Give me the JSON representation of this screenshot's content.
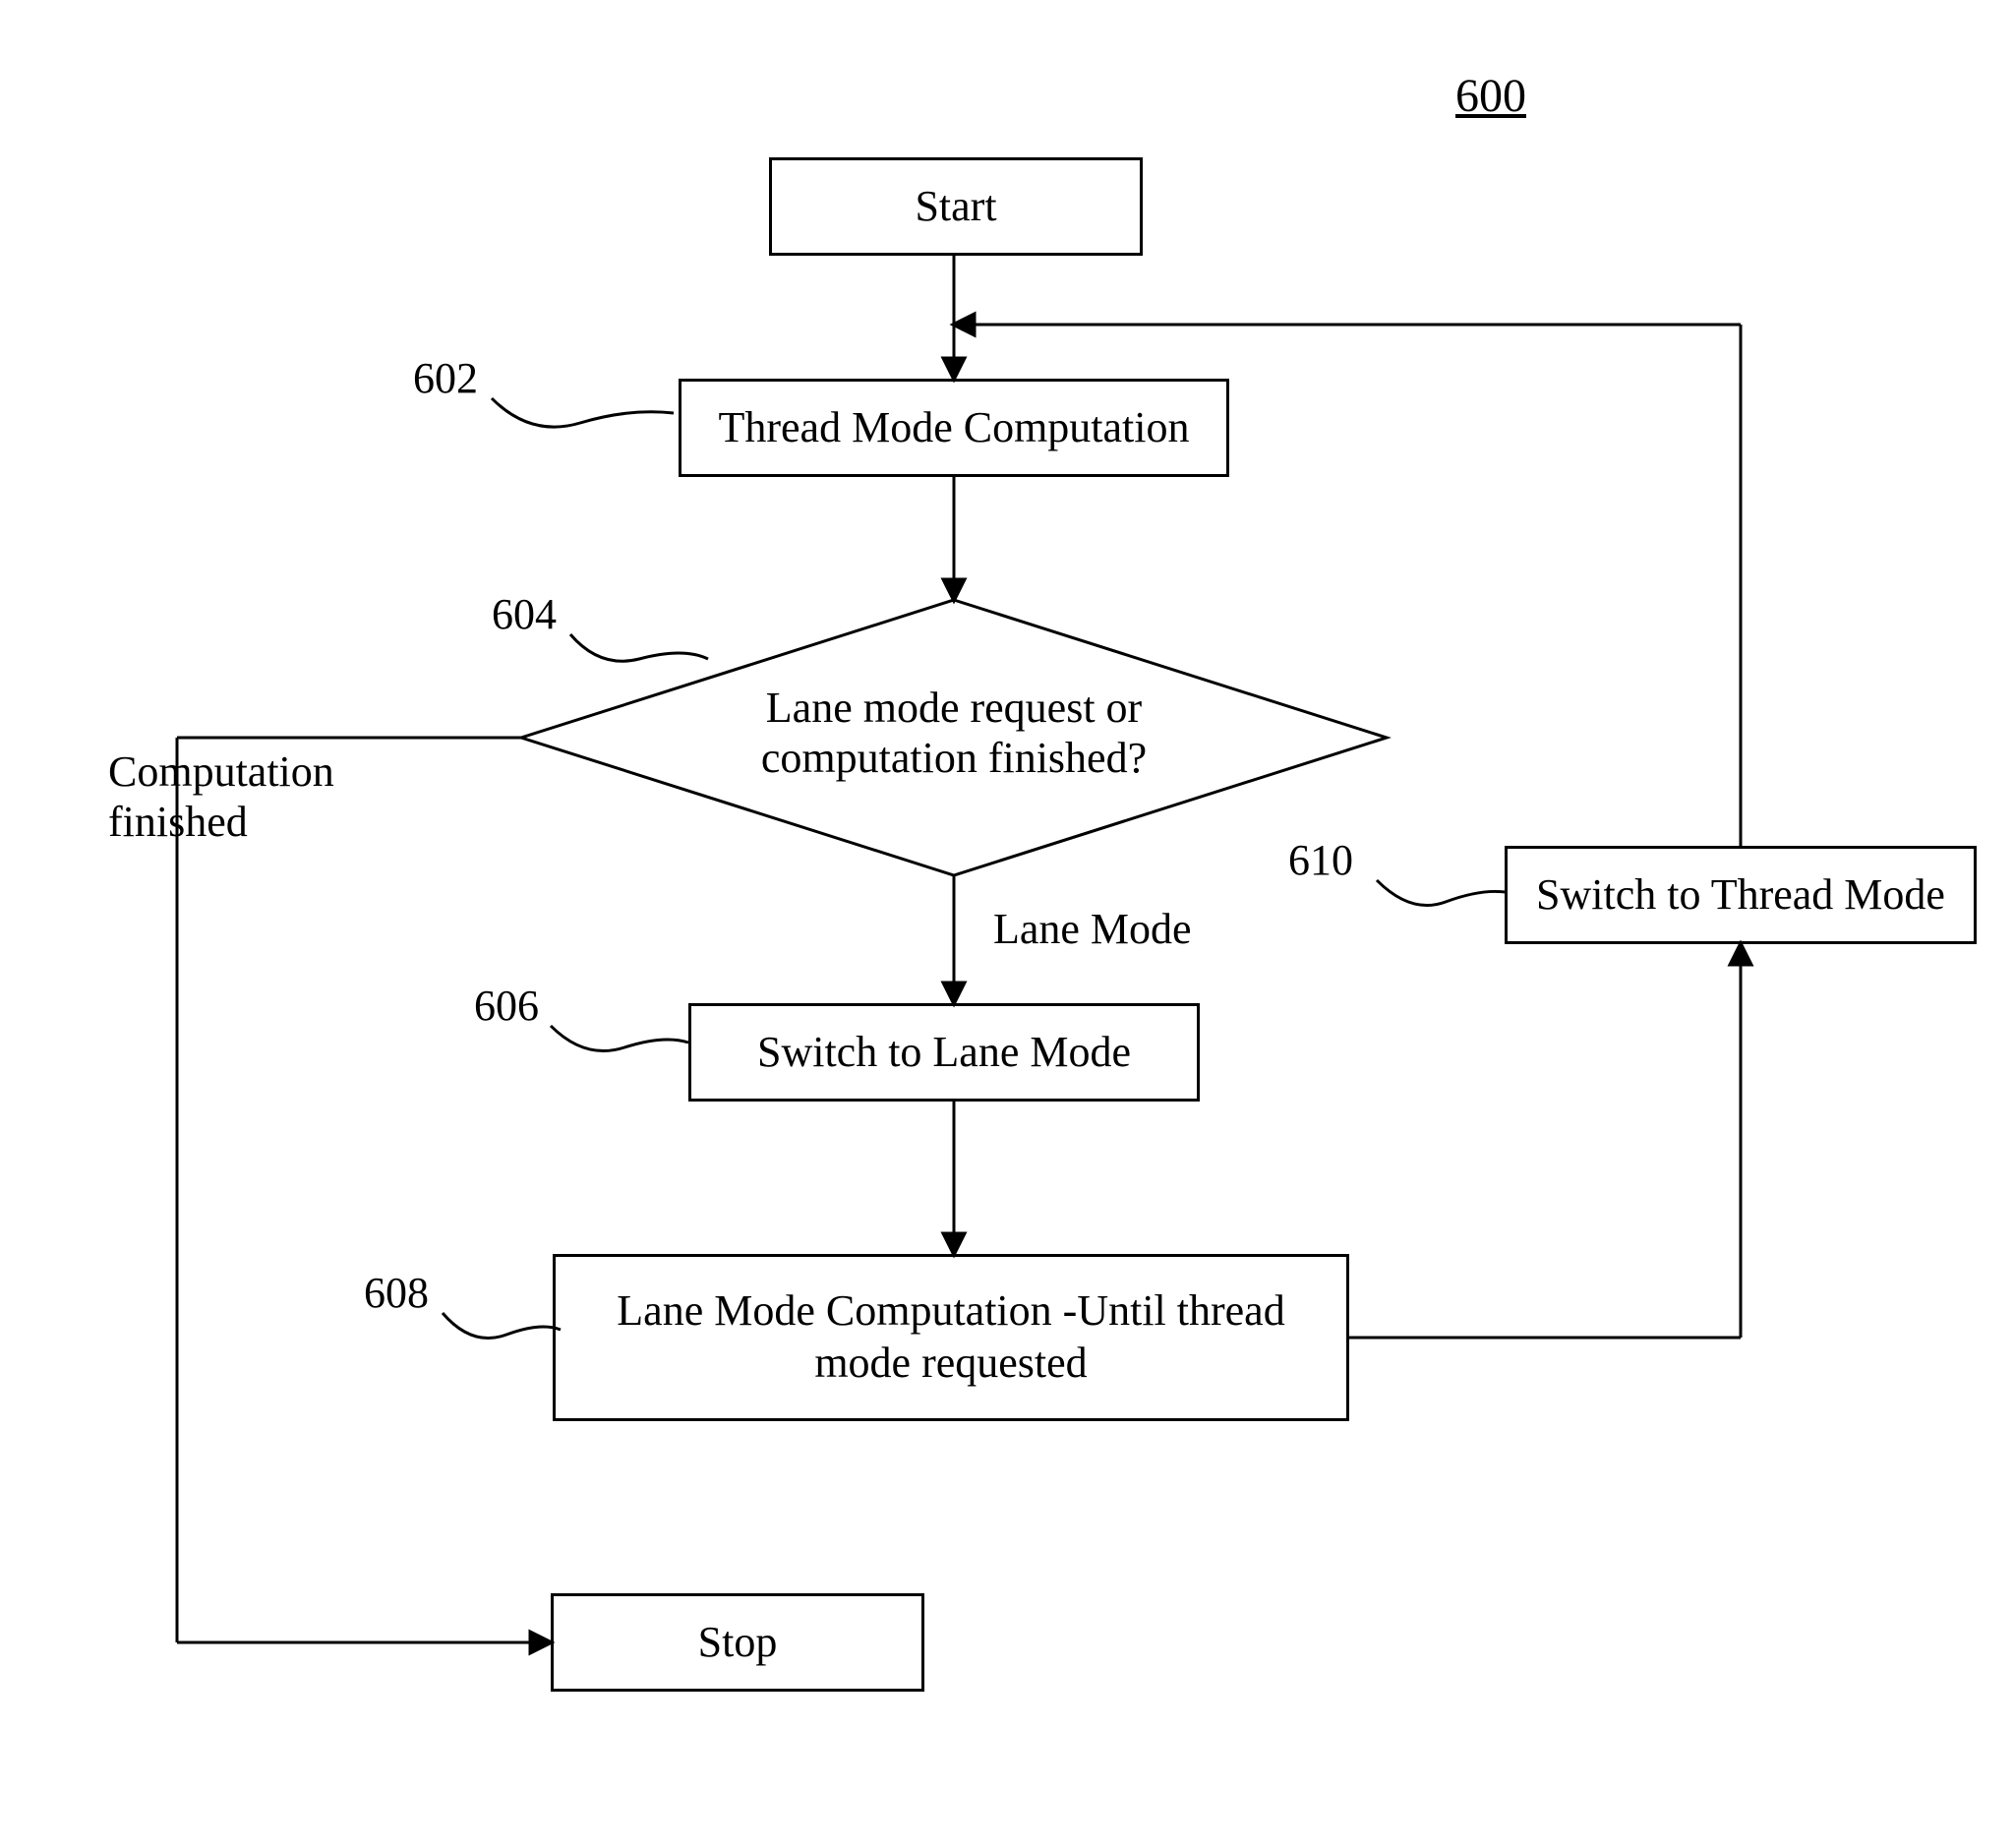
{
  "figure_ref": "600",
  "nodes": {
    "start": "Start",
    "thread_mode_computation": "Thread Mode Computation",
    "decision": "Lane mode request or\ncomputation finished?",
    "switch_to_lane_mode": "Switch to Lane Mode",
    "lane_mode_computation": "Lane Mode Computation\n-Until thread mode requested",
    "switch_to_thread_mode": "Switch to Thread Mode",
    "stop": "Stop"
  },
  "edge_labels": {
    "computation_finished": "Computation\nfinished",
    "lane_mode": "Lane Mode"
  },
  "callouts": {
    "n602": "602",
    "n604": "604",
    "n606": "606",
    "n608": "608",
    "n610": "610"
  },
  "chart_data": {
    "type": "flowchart",
    "nodes": [
      {
        "id": "start",
        "kind": "terminator",
        "label": "Start"
      },
      {
        "id": "threadModeComp",
        "kind": "process",
        "label": "Thread Mode Computation",
        "ref": "602"
      },
      {
        "id": "decision",
        "kind": "decision",
        "label": "Lane mode request or computation finished?",
        "ref": "604"
      },
      {
        "id": "switchLane",
        "kind": "process",
        "label": "Switch to Lane Mode",
        "ref": "606"
      },
      {
        "id": "laneModeComp",
        "kind": "process",
        "label": "Lane Mode Computation - Until thread mode requested",
        "ref": "608"
      },
      {
        "id": "switchThread",
        "kind": "process",
        "label": "Switch to Thread Mode",
        "ref": "610"
      },
      {
        "id": "stop",
        "kind": "terminator",
        "label": "Stop"
      }
    ],
    "edges": [
      {
        "from": "start",
        "to": "threadModeComp"
      },
      {
        "from": "threadModeComp",
        "to": "decision"
      },
      {
        "from": "decision",
        "to": "switchLane",
        "label": "Lane Mode"
      },
      {
        "from": "decision",
        "to": "stop",
        "label": "Computation finished"
      },
      {
        "from": "switchLane",
        "to": "laneModeComp"
      },
      {
        "from": "laneModeComp",
        "to": "switchThread"
      },
      {
        "from": "switchThread",
        "to": "threadModeComp"
      }
    ],
    "figure_ref": "600"
  }
}
